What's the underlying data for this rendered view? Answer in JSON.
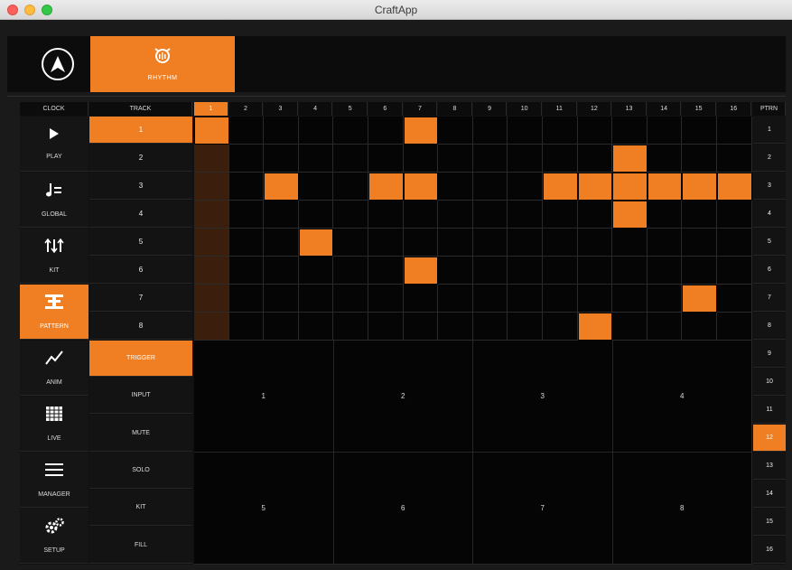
{
  "window": {
    "title": "CraftApp"
  },
  "top_tabs": [
    {
      "label": "RHYTHM",
      "icon": "rhythm-icon"
    }
  ],
  "headers": {
    "clock": "CLOCK",
    "track": "TRACK",
    "steps": [
      "1",
      "2",
      "3",
      "4",
      "5",
      "6",
      "7",
      "8",
      "9",
      "10",
      "11",
      "12",
      "13",
      "14",
      "15",
      "16"
    ],
    "ptrn": "PTRN"
  },
  "nav": [
    {
      "label": "PLAY",
      "icon": "play-icon",
      "active": false
    },
    {
      "label": "GLOBAL",
      "icon": "tempo-icon",
      "active": false
    },
    {
      "label": "KIT",
      "icon": "sliders-icon",
      "active": false
    },
    {
      "label": "PATTERN",
      "icon": "pattern-icon",
      "active": true
    },
    {
      "label": "ANIM",
      "icon": "graph-icon",
      "active": false
    },
    {
      "label": "LIVE",
      "icon": "grid-icon",
      "active": false
    },
    {
      "label": "MANAGER",
      "icon": "menu-icon",
      "active": false
    },
    {
      "label": "SETUP",
      "icon": "gears-icon",
      "active": false
    }
  ],
  "tracks": [
    "1",
    "2",
    "3",
    "4",
    "5",
    "6",
    "7",
    "8"
  ],
  "selected_track": "1",
  "playhead_step": "1",
  "active_steps": [
    [
      "1",
      "7"
    ],
    [
      "13"
    ],
    [
      "3",
      "6",
      "7",
      "11",
      "12",
      "13",
      "14",
      "15",
      "16"
    ],
    [
      "13"
    ],
    [
      "4"
    ],
    [
      "7"
    ],
    [
      "15"
    ],
    [
      "12"
    ]
  ],
  "modes": [
    {
      "label": "TRIGGER",
      "active": true
    },
    {
      "label": "INPUT",
      "active": false
    },
    {
      "label": "MUTE",
      "active": false
    },
    {
      "label": "SOLO",
      "active": false
    },
    {
      "label": "KIT",
      "active": false
    },
    {
      "label": "FILL",
      "active": false
    }
  ],
  "pattern_blocks": [
    "1",
    "2",
    "3",
    "4",
    "5",
    "6",
    "7",
    "8"
  ],
  "ptrn": [
    "1",
    "2",
    "3",
    "4",
    "5",
    "6",
    "7",
    "8",
    "9",
    "10",
    "11",
    "12",
    "13",
    "14",
    "15",
    "16"
  ],
  "selected_ptrn": "12",
  "colors": {
    "accent": "#ef7f22",
    "playhead": "#3b1f0c",
    "background": "#050505"
  }
}
